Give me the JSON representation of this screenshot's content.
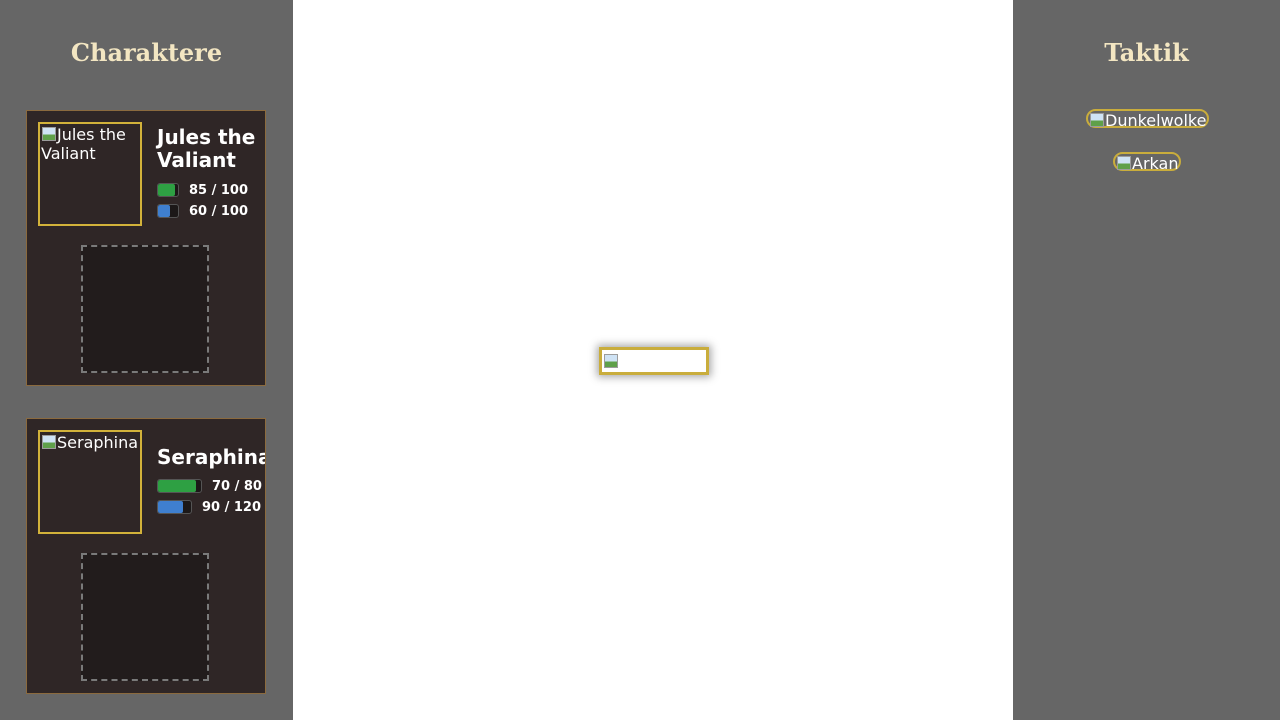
{
  "left_panel": {
    "title": "Charaktere",
    "characters": [
      {
        "name": "Jules the\nValiant",
        "portrait_alt": "Jules the Valiant",
        "hp": {
          "current": 85,
          "max": 100,
          "text": "85 / 100"
        },
        "mp": {
          "current": 60,
          "max": 100,
          "text": "60 / 100"
        }
      },
      {
        "name": "Seraphina",
        "portrait_alt": "Seraphina",
        "hp": {
          "current": 70,
          "max": 80,
          "text": "70 / 80"
        },
        "mp": {
          "current": 90,
          "max": 120,
          "text": "90 / 120"
        }
      }
    ]
  },
  "right_panel": {
    "title": "Taktik",
    "tactics": [
      {
        "label": "Dunkelwolke"
      },
      {
        "label": "Arkan"
      }
    ]
  },
  "colors": {
    "panel_bg": "#666666",
    "card_bg": "#2f2626",
    "title_color": "#f3e6c2",
    "gold_border": "#d2b23a",
    "hp_fill": "#2ea043",
    "mp_fill": "#3f7fcf"
  }
}
